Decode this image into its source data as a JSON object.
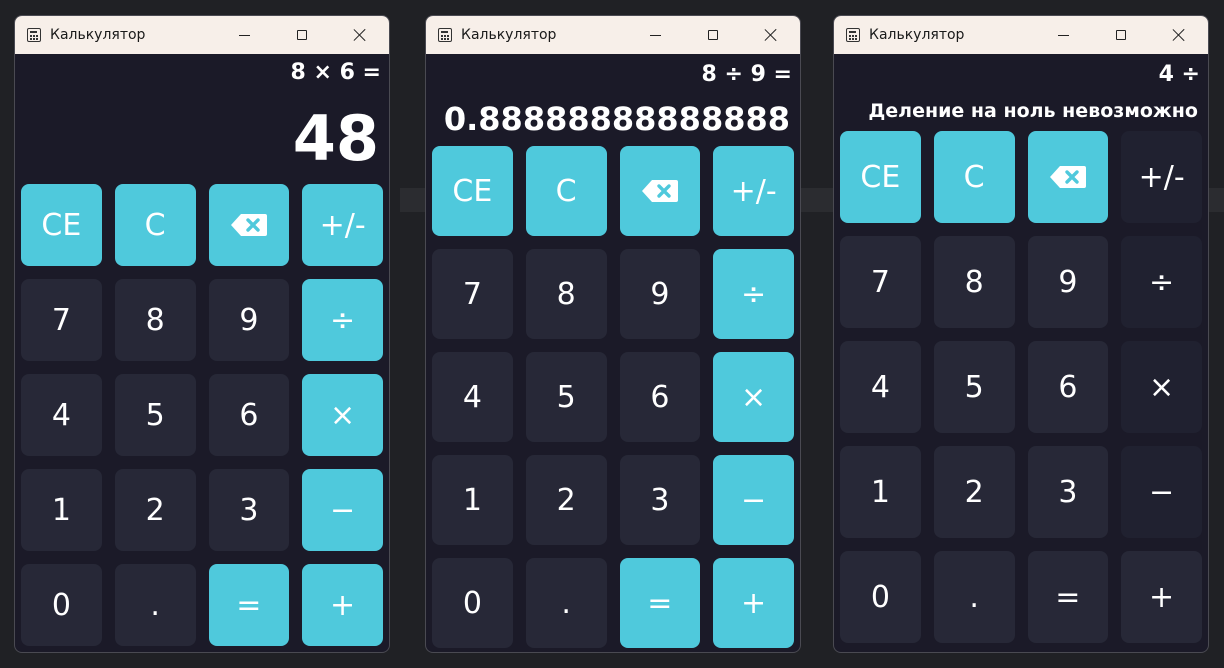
{
  "colors": {
    "accent": "#4fc9dc",
    "key_background": "#272837",
    "window_background": "#1b1a28",
    "titlebar": "#f7efe9"
  },
  "windows": [
    {
      "title": "Калькулятор",
      "expression": "8 × 6 =",
      "result": "48",
      "keys": [
        {
          "label": "CE",
          "style": "accent"
        },
        {
          "label": "C",
          "style": "accent"
        },
        {
          "label": "",
          "icon": "backspace-icon",
          "style": "accent"
        },
        {
          "label": "+/-",
          "style": "accent"
        },
        {
          "label": "7",
          "style": "normal"
        },
        {
          "label": "8",
          "style": "normal"
        },
        {
          "label": "9",
          "style": "normal"
        },
        {
          "label": "÷",
          "style": "accent"
        },
        {
          "label": "4",
          "style": "normal"
        },
        {
          "label": "5",
          "style": "normal"
        },
        {
          "label": "6",
          "style": "normal"
        },
        {
          "label": "×",
          "style": "accent"
        },
        {
          "label": "1",
          "style": "normal"
        },
        {
          "label": "2",
          "style": "normal"
        },
        {
          "label": "3",
          "style": "normal"
        },
        {
          "label": "−",
          "style": "accent"
        },
        {
          "label": "0",
          "style": "normal"
        },
        {
          "label": ".",
          "style": "normal"
        },
        {
          "label": "=",
          "style": "accent"
        },
        {
          "label": "+",
          "style": "accent"
        }
      ]
    },
    {
      "title": "Калькулятор",
      "expression": "8 ÷ 9 =",
      "result": "0.88888888888888",
      "keys": [
        {
          "label": "CE",
          "style": "accent"
        },
        {
          "label": "C",
          "style": "accent"
        },
        {
          "label": "",
          "icon": "backspace-icon",
          "style": "accent"
        },
        {
          "label": "+/-",
          "style": "accent"
        },
        {
          "label": "7",
          "style": "normal"
        },
        {
          "label": "8",
          "style": "normal"
        },
        {
          "label": "9",
          "style": "normal"
        },
        {
          "label": "÷",
          "style": "accent"
        },
        {
          "label": "4",
          "style": "normal"
        },
        {
          "label": "5",
          "style": "normal"
        },
        {
          "label": "6",
          "style": "normal"
        },
        {
          "label": "×",
          "style": "accent"
        },
        {
          "label": "1",
          "style": "normal"
        },
        {
          "label": "2",
          "style": "normal"
        },
        {
          "label": "3",
          "style": "normal"
        },
        {
          "label": "−",
          "style": "accent"
        },
        {
          "label": "0",
          "style": "normal"
        },
        {
          "label": ".",
          "style": "normal"
        },
        {
          "label": "=",
          "style": "accent"
        },
        {
          "label": "+",
          "style": "accent"
        }
      ]
    },
    {
      "title": "Калькулятор",
      "expression": "4 ÷",
      "result": "Деление на ноль невозможно",
      "keys": [
        {
          "label": "CE",
          "style": "accent"
        },
        {
          "label": "C",
          "style": "accent"
        },
        {
          "label": "",
          "icon": "backspace-icon",
          "style": "accent"
        },
        {
          "label": "+/-",
          "style": "dim"
        },
        {
          "label": "7",
          "style": "normal"
        },
        {
          "label": "8",
          "style": "normal"
        },
        {
          "label": "9",
          "style": "normal"
        },
        {
          "label": "÷",
          "style": "dim"
        },
        {
          "label": "4",
          "style": "normal"
        },
        {
          "label": "5",
          "style": "normal"
        },
        {
          "label": "6",
          "style": "normal"
        },
        {
          "label": "×",
          "style": "dim"
        },
        {
          "label": "1",
          "style": "normal"
        },
        {
          "label": "2",
          "style": "normal"
        },
        {
          "label": "3",
          "style": "normal"
        },
        {
          "label": "−",
          "style": "dim"
        },
        {
          "label": "0",
          "style": "normal"
        },
        {
          "label": ".",
          "style": "normal"
        },
        {
          "label": "=",
          "style": "normal"
        },
        {
          "label": "+",
          "style": "normal"
        }
      ]
    }
  ]
}
